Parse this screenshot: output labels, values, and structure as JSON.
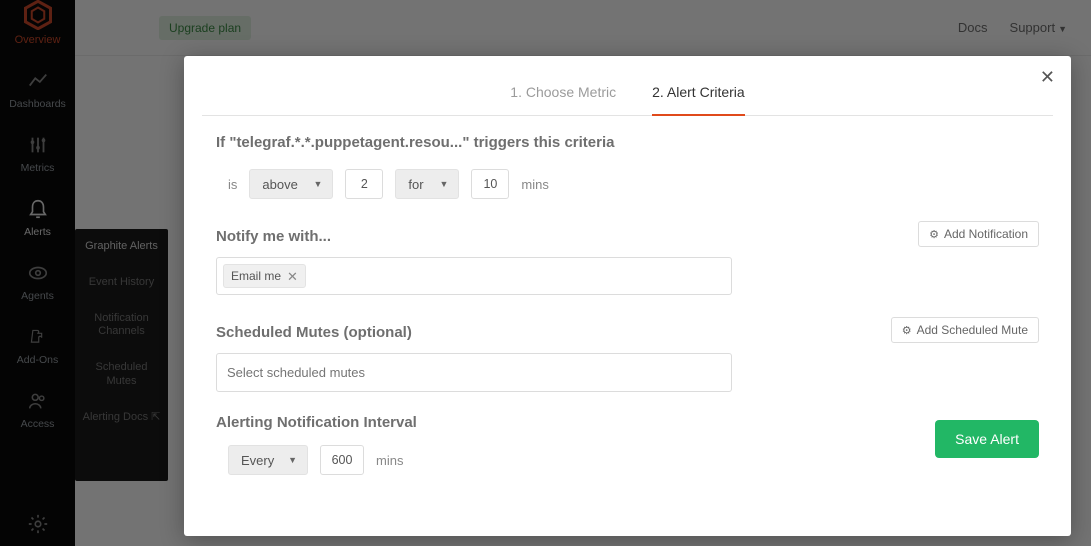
{
  "sidebar": {
    "logo_label": "Overview",
    "items": [
      {
        "label": "Dashboards"
      },
      {
        "label": "Metrics"
      },
      {
        "label": "Alerts"
      },
      {
        "label": "Agents"
      },
      {
        "label": "Add-Ons"
      },
      {
        "label": "Access"
      }
    ]
  },
  "subside": {
    "items": [
      "Graphite Alerts",
      "Event History",
      "Notification Channels",
      "Scheduled Mutes",
      "Alerting Docs ⇱"
    ]
  },
  "topbar": {
    "upgrade": "Upgrade plan",
    "docs": "Docs",
    "support": "Support"
  },
  "modal": {
    "tabs": {
      "choose_metric": "1. Choose Metric",
      "alert_criteria": "2. Alert Criteria"
    },
    "criteria_sentence": "If \"telegraf.*.*.puppetagent.resou...\" triggers this criteria",
    "criteria": {
      "is_label": "is",
      "comparator": "above",
      "threshold_value": "2",
      "for_label": "for",
      "duration_value": "10",
      "mins_label": "mins"
    },
    "notify": {
      "title": "Notify me with...",
      "add_btn": "Add Notification",
      "chip_label": "Email me"
    },
    "mutes": {
      "title": "Scheduled Mutes (optional)",
      "add_btn": "Add Scheduled Mute",
      "placeholder": "Select scheduled mutes"
    },
    "interval": {
      "title": "Alerting Notification Interval",
      "mode": "Every",
      "value": "600",
      "mins_label": "mins"
    },
    "save": "Save Alert"
  }
}
